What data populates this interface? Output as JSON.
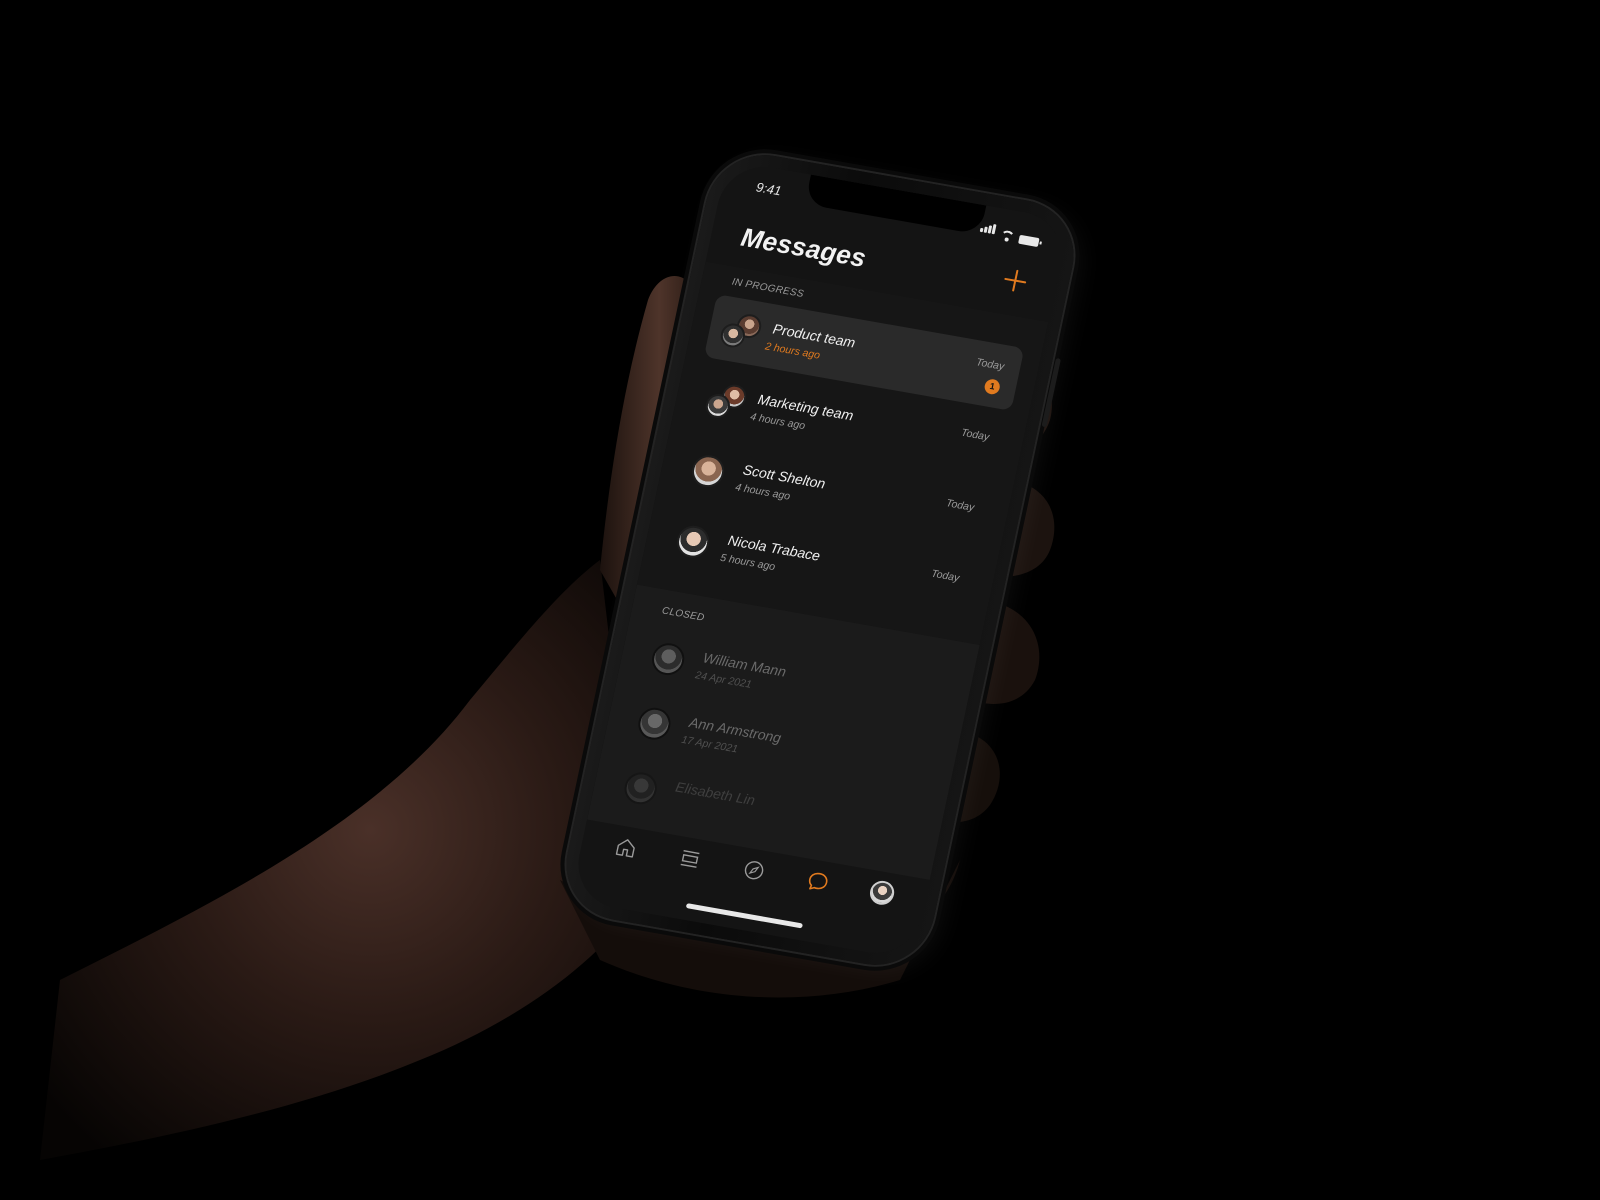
{
  "status_bar": {
    "time": "9:41"
  },
  "header": {
    "title": "Messages"
  },
  "sections": {
    "in_progress_label": "IN PROGRESS",
    "closed_label": "CLOSED"
  },
  "in_progress": [
    {
      "name": "Product team",
      "sub": "2 hours ago",
      "date": "Today",
      "badge": "1"
    },
    {
      "name": "Marketing team",
      "sub": "4 hours ago",
      "date": "Today"
    },
    {
      "name": "Scott Shelton",
      "sub": "4 hours ago",
      "date": "Today"
    },
    {
      "name": "Nicola Trabace",
      "sub": "5 hours ago",
      "date": "Today"
    }
  ],
  "closed": [
    {
      "name": "William Mann",
      "sub": "24 Apr 2021"
    },
    {
      "name": "Ann Armstrong",
      "sub": "17 Apr 2021"
    },
    {
      "name": "Elisabeth Lin",
      "sub": ""
    }
  ],
  "tab_bar": {
    "tabs": [
      "home-icon",
      "list-icon",
      "compass-icon",
      "chat-icon",
      "profile-avatar"
    ],
    "active": "chat-icon"
  },
  "colors": {
    "accent": "#e07a1f",
    "background": "#000000",
    "screen": "#141414"
  }
}
